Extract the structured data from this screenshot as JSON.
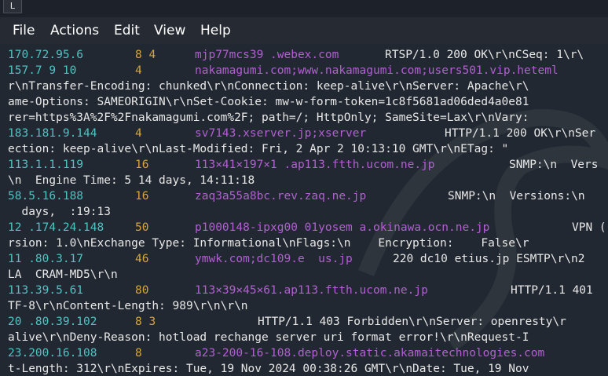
{
  "window": {
    "icon_glyph": "L"
  },
  "menu": {
    "items": [
      {
        "label": "File"
      },
      {
        "label": "Actions"
      },
      {
        "label": "Edit"
      },
      {
        "label": "View"
      },
      {
        "label": "Help"
      }
    ]
  },
  "terminal": {
    "lines": [
      {
        "ip": "170.72.95.6",
        "port": "8 4",
        "host": "mjp77mcs39 .webex.com",
        "info": "RTSP/1.0 200 OK\\r\\nCSeq: 1\\r\\"
      },
      {
        "ip": "157.7 9 10",
        "port": "4",
        "host": "nakamagumi.com;www.nakamagumi.com;users501.vip.heteml",
        "info": ""
      },
      {
        "text": "r\\nTransfer-Encoding: chunked\\r\\nConnection: keep-alive\\r\\nServer: Apache\\r\\"
      },
      {
        "text": "ame-Options: SAMEORIGIN\\r\\nSet-Cookie: mw-w-form-token=1c8f5681ad06ded4a0e81"
      },
      {
        "text": "rer=https%3A%2F%2Fnakamagumi.com%2F; path=/; HttpOnly; SameSite=Lax\\r\\nVary: "
      },
      {
        "ip": "183.181.9.144",
        "port": "4",
        "host": "sv7143.xserver.jp;xserver",
        "info": "HTTP/1.1 200 OK\\r\\nSer"
      },
      {
        "text": "ection: keep-alive\\r\\nLast-Modified: Fri, 2 Apr 2 10:13:10 GMT\\r\\nETag: \""
      },
      {
        "ip": "113.1.1.119",
        "port": "16",
        "host": "113×41×197×1 .ap113.ftth.ucom.ne.jp",
        "info": "SNMP:\\n  Vers"
      },
      {
        "text": "\\n  Engine Time: 5 14 days, 14:11:18"
      },
      {
        "ip": "58.5.16.188",
        "port": "16",
        "host": "zaq3a55a8bc.rev.zaq.ne.jp",
        "info": "SNMP:\\n  Versions:\\n"
      },
      {
        "text": "  days,  :19:13"
      },
      {
        "ip": "12 .174.24.148",
        "port": "50",
        "host": "p1000148-ipxg00 01yosem a.okinawa.ocn.ne.jp",
        "info": "VPN ("
      },
      {
        "text": "rsion: 1.0\\nExchange Type: Informational\\nFlags:\\n    Encryption:    False\\r"
      },
      {
        "ip": "11 .80.3.17",
        "port": "46",
        "host": "ymwk.com;dc109.e  us.jp",
        "info": "220 dc10 etius.jp ESMTP\\r\\n2"
      },
      {
        "text": "LA  CRAM-MD5\\r\\n"
      },
      {
        "ip": "113.39.5.61",
        "port": "80",
        "host": "113×39×45×61.ap113.ftth.ucom.ne.jp",
        "info": "HTTP/1.1 401"
      },
      {
        "text": "TF-8\\r\\nContent-Length: 989\\r\\n\\r\\n"
      },
      {
        "ip": "20 .80.39.102",
        "port": "8 3",
        "host": "",
        "info": "HTTP/1.1 403 Forbidden\\r\\nServer: openresty\\r"
      },
      {
        "text": "alive\\r\\nDeny-Reason: hotload rechange server uri format error!\\r\\nRequest-I"
      },
      {
        "ip": "23.200.16.108",
        "port": "8",
        "host": "a23-200-16-108.deploy.static.akamaitechnologies.com",
        "info": ""
      },
      {
        "text": "t-Length: 312\\r\\nExpires: Tue, 19 Nov 2024 00:38:26 GMT\\r\\nDate: Tue, 19 Nov"
      }
    ]
  },
  "colors": {
    "background": "#222831",
    "ip": "#4fc2c2",
    "port": "#d8a43a",
    "host": "#b060d0",
    "text": "#e8e8e8"
  }
}
